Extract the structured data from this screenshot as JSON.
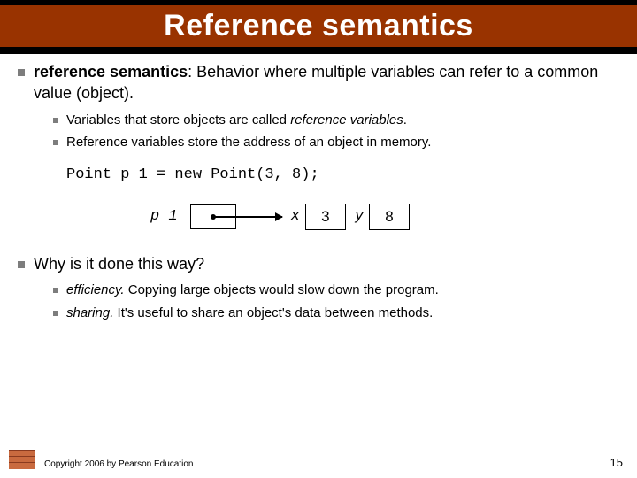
{
  "title": "Reference semantics",
  "intro": {
    "term": "reference semantics",
    "definition": ": Behavior where multiple variables can refer to a common value (object)."
  },
  "sub1": {
    "a_pre": "Variables that store objects are called ",
    "a_em": "reference variables",
    "a_post": ".",
    "b": "Reference variables store the address of an object in memory."
  },
  "code": "Point p 1 = new Point(3, 8);",
  "diagram": {
    "var": "p 1",
    "fx_label": "x",
    "fx_val": "3",
    "fy_label": "y",
    "fy_val": "8"
  },
  "question": "Why is it done this way?",
  "sub2": {
    "a_em": "efficiency.",
    "a_rest": "  Copying large objects would slow down the program.",
    "b_em": "sharing.",
    "b_rest": "  It's useful to share an object's data between methods."
  },
  "footer": {
    "copyright": "Copyright 2006 by Pearson Education",
    "page": "15"
  }
}
